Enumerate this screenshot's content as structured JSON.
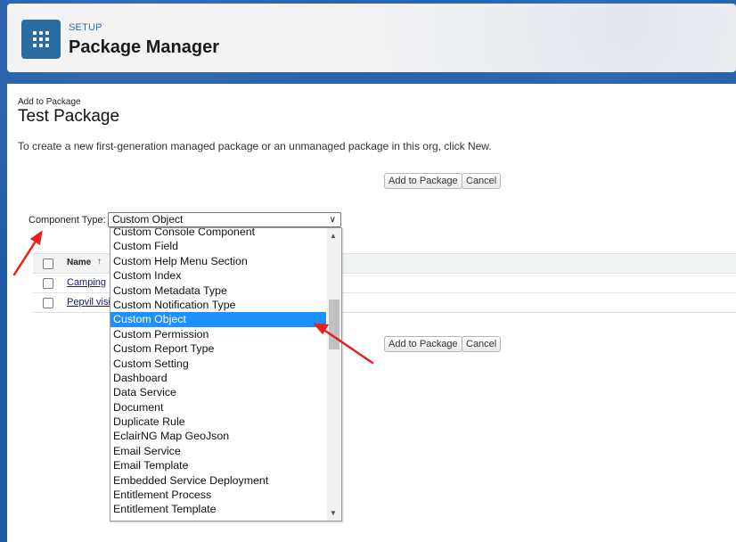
{
  "header": {
    "section": "SETUP",
    "title": "Package Manager",
    "icon": "app-grid-icon"
  },
  "page": {
    "subtitle": "Add to Package",
    "title": "Test Package",
    "instructions": "To create a new first-generation managed package or an unmanaged package in this org, click New."
  },
  "buttons": {
    "add_label": "Add to Package",
    "cancel_label": "Cancel"
  },
  "component_type": {
    "label": "Component Type:",
    "selected": "Custom Object",
    "options": [
      "Custom Console Component",
      "Custom Field",
      "Custom Help Menu Section",
      "Custom Index",
      "Custom Metadata Type",
      "Custom Notification Type",
      "Custom Object",
      "Custom Permission",
      "Custom Report Type",
      "Custom Setting",
      "Dashboard",
      "Data Service",
      "Document",
      "Duplicate Rule",
      "EclairNG Map GeoJson",
      "Email Service",
      "Email Template",
      "Embedded Service Deployment",
      "Entitlement Process",
      "Entitlement Template"
    ]
  },
  "table": {
    "name_header": "Name",
    "sort_indicator": "↑",
    "rows": [
      "Camping",
      "Pepvil visi"
    ]
  },
  "colors": {
    "brand_blue": "#1e5aa8",
    "selected_option": "#1e90ff",
    "annotation_arrow": "#e8201b"
  }
}
